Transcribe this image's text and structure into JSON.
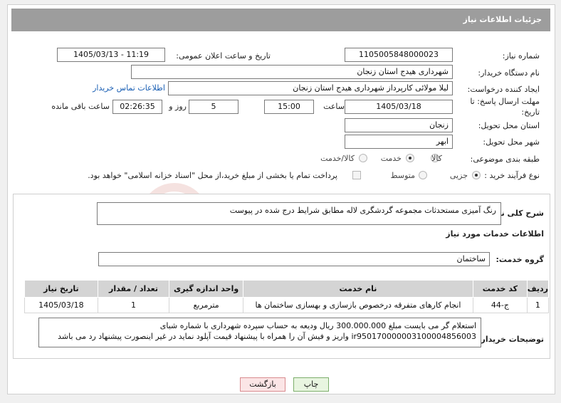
{
  "page": {
    "title": "جزئیات اطلاعات نیاز"
  },
  "fields": {
    "need_number_label": "شماره نیاز:",
    "need_number": "1105005848000023",
    "announce_label": "تاریخ و ساعت اعلان عمومی:",
    "announce_value": "1405/03/13 - 11:19",
    "buyer_org_label": "نام دستگاه خریدار:",
    "buyer_org": "شهرداری هیدج استان زنجان",
    "creator_label": "ایجاد کننده درخواست:",
    "creator": "لیلا مولائی کارپرداز شهرداری هیدج استان زنجان",
    "contact_link": "اطلاعات تماس خریدار",
    "deadline_label_1": "مهلت ارسال پاسخ: تا",
    "deadline_label_2": "تاریخ:",
    "deadline_date": "1405/03/18",
    "hour_label": "ساعت",
    "deadline_hour": "15:00",
    "days_value": "5",
    "days_label": "روز و",
    "remaining_time": "02:26:35",
    "remaining_label": "ساعت باقی مانده",
    "province_label": "استان محل تحویل:",
    "province": "زنجان",
    "city_label": "شهر محل تحویل:",
    "city": "ابهر",
    "category_label": "طبقه بندی موضوعی:",
    "category_options": [
      "کالا",
      "خدمت",
      "کالا/خدمت"
    ],
    "category_selected": "خدمت",
    "process_label": "نوع فرآیند خرید :",
    "process_options": [
      "جزیی",
      "متوسط"
    ],
    "process_selected": "جزیی",
    "payment_note": "پرداخت تمام یا بخشی از مبلغ خرید،از محل \"اسناد خزانه اسلامی\" خواهد بود."
  },
  "description": {
    "label": "شرح کلی نیاز:",
    "value": "رنگ آمیزی مستحدثات مجموعه گردشگری لاله مطابق شرایط درج شده در پیوست"
  },
  "services": {
    "heading": "اطلاعات خدمات مورد نیاز",
    "group_label": "گروه خدمت:",
    "group_value": "ساختمان",
    "columns": [
      "ردیف",
      "کد خدمت",
      "نام خدمت",
      "واحد اندازه گیری",
      "تعداد / مقدار",
      "تاریخ نیاز"
    ],
    "rows": [
      [
        "1",
        "ج-44",
        "انجام کارهای متفرقه درخصوص بازسازی و بهسازی ساختمان ها",
        "مترمربع",
        "1",
        "1405/03/18"
      ]
    ]
  },
  "buyer_notes": {
    "label": "توضیحات خریدار:",
    "line1": "استعلام گر می بایست مبلغ 300.000.000 ریال ودیعه به حساب سپرده شهرداری با شماره شبای",
    "line2": "ir950170000003100004856003  واریز و فیش آن را همراه با پیشنهاد قیمت آپلود نماید در غیر اینصورت پیشنهاد رد می باشد"
  },
  "buttons": {
    "print": "چاپ",
    "back": "بازگشت"
  },
  "watermark": {
    "text": "AriaTender.neT",
    "color": "#c0392b"
  },
  "colors": {
    "titlebar": "#9d9d9d",
    "link": "#1a5fb4"
  }
}
